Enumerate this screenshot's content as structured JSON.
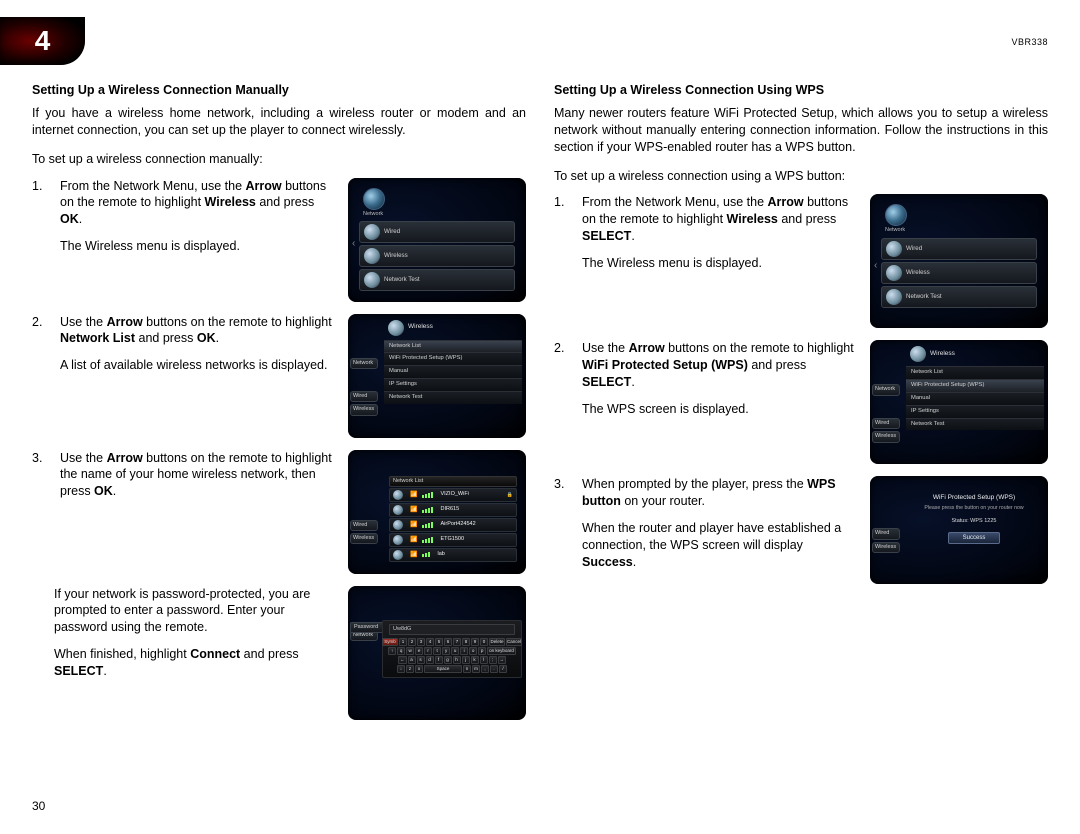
{
  "chapter_number": "4",
  "model": "VBR338",
  "page_number": "30",
  "left": {
    "title": "Setting Up a Wireless Connection Manually",
    "intro": "If you have a wireless home network, including a wireless router or modem and an internet connection, you can set up the player to connect wirelessly.",
    "lead": "To set up a wireless connection manually:",
    "step1_a": "From the Network Menu, use the ",
    "step1_b": " buttons on the remote to highlight ",
    "step1_c": " and press ",
    "step1_bold1": "Arrow",
    "step1_bold2": "Wireless",
    "step1_bold3": "OK",
    "step1_d": ".",
    "step1_sub": "The Wireless menu is displayed.",
    "step2_a": "Use the ",
    "step2_b": " buttons on the remote to highlight ",
    "step2_c": " and press ",
    "step2_bold1": "Arrow",
    "step2_bold2": "Network List",
    "step2_bold3": "OK",
    "step2_d": ".",
    "step2_sub": "A list of available wireless networks is displayed.",
    "step3_a": "Use the ",
    "step3_b": " buttons on the remote to highlight the name of your home wireless network, then press ",
    "step3_bold1": "Arrow",
    "step3_bold2": "OK",
    "step3_c": ".",
    "after1": "If your network is password-protected, you are prompted to enter a password. Enter your password using the remote.",
    "after2_a": "When finished, highlight ",
    "after2_bold": "Connect",
    "after2_b": " and press ",
    "after2_bold2": "SELECT",
    "after2_c": "."
  },
  "right": {
    "title": "Setting Up a Wireless Connection Using WPS",
    "intro": "Many newer routers feature WiFi Protected Setup, which allows you to setup a wireless network without manually entering connection information. Follow the instructions in this section if your WPS-enabled router has a WPS button.",
    "lead": "To set up a wireless connection using a WPS button:",
    "step1_a": "From the Network Menu, use the ",
    "step1_b": " buttons on the remote to highlight ",
    "step1_c": " and press ",
    "step1_bold1": "Arrow",
    "step1_bold2": "Wireless",
    "step1_bold3": "SELECT",
    "step1_d": ".",
    "step1_sub": "The Wireless menu is displayed.",
    "step2_a": "Use the ",
    "step2_b": " buttons on the remote to highlight ",
    "step2_c": " and press ",
    "step2_bold1": "Arrow",
    "step2_bold2": "WiFi Protected Setup (WPS)",
    "step2_bold3": "SELECT",
    "step2_d": ".",
    "step2_sub": "The WPS screen is displayed.",
    "step3_a": "When prompted by the player, press the ",
    "step3_bold": "WPS button",
    "step3_b": " on your router.",
    "step3_sub_a": "When the router and player have established a connection, the WPS screen will display ",
    "step3_sub_bold": "Success",
    "step3_sub_b": "."
  },
  "shots": {
    "network_label": "Network",
    "wired": "Wired",
    "wireless": "Wireless",
    "network_test": "Network Test",
    "network_list": "Network List",
    "wps": "WiFi Protected Setup (WPS)",
    "manual": "Manual",
    "ip_settings": "IP Settings",
    "net_list_title": "Network List",
    "ssid1": "VIZIO_WiFi",
    "ssid2": "DIR615",
    "ssid3": "AirPort424542",
    "ssid4": "ETG1500",
    "ssid5": "lab",
    "password": "Password",
    "kbd_field": "Uw8dG",
    "delete": "Delete",
    "cancel": "Cancel",
    "keyboard_hint": "on keyboard",
    "symb": "Symb",
    "space": "Space",
    "wps_title": "WiFi Protected Setup (WPS)",
    "wps_sub": "Please press the button on your router now",
    "wps_status": "Status: WPS 1225",
    "wps_success": "Success"
  }
}
